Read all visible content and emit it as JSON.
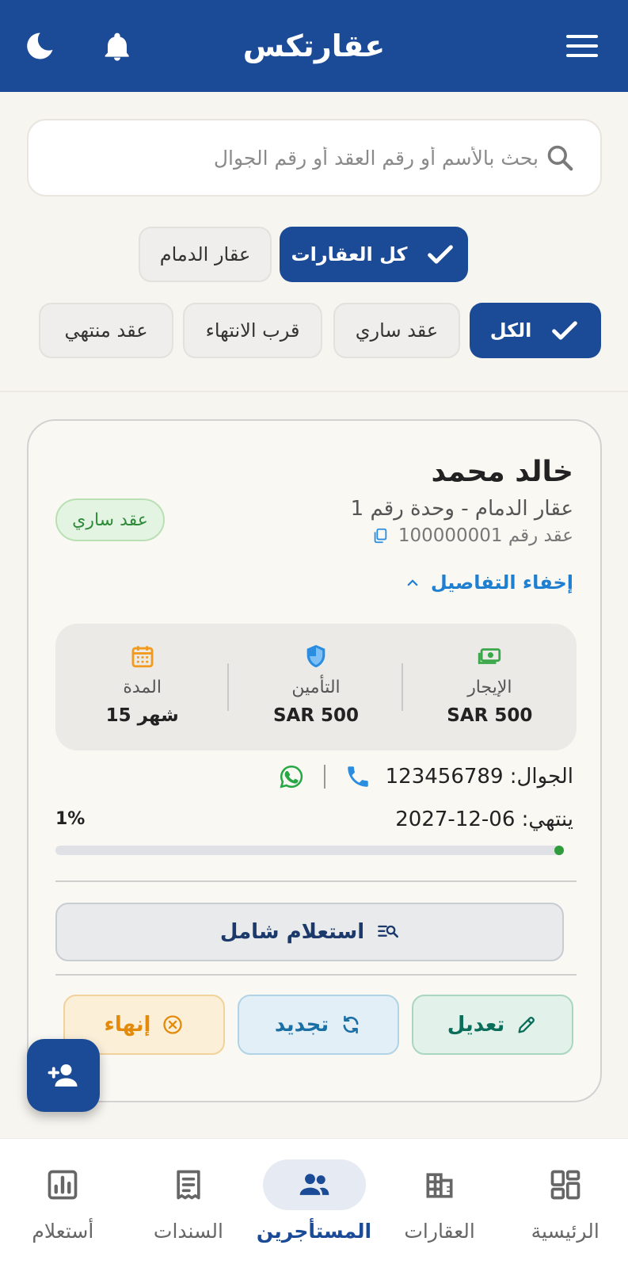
{
  "header": {
    "title": "عقارتكس",
    "colors": {
      "primary": "#1b4a96"
    },
    "icons": {
      "menu": "menu-icon",
      "bell": "bell-icon",
      "theme": "moon-icon"
    }
  },
  "search": {
    "placeholder": "بحث بالأسم أو رقم العقد أو رقم الجوال",
    "value": "",
    "icon": "search-icon"
  },
  "property_filters": [
    {
      "label": "كل العقارات",
      "selected": true
    },
    {
      "label": "عقار الدمام",
      "selected": false
    }
  ],
  "status_filters": [
    {
      "label": "الكل",
      "selected": true
    },
    {
      "label": "عقد ساري",
      "selected": false
    },
    {
      "label": "قرب الانتهاء",
      "selected": false
    },
    {
      "label": "عقد منتهي",
      "selected": false
    }
  ],
  "card": {
    "tenant_name": "خالد محمد",
    "unit": "عقار الدمام - وحدة رقم 1",
    "contract_no": "عقد رقم 100000001",
    "status": {
      "label": "عقد ساري",
      "color": "#2e8b3a"
    },
    "toggle_details": "إخفاء التفاصيل",
    "stats": {
      "rent": {
        "label": "الإيجار",
        "value": "SAR 500",
        "icon": "money-icon"
      },
      "insurance": {
        "label": "التأمين",
        "value": "SAR 500",
        "icon": "shield-icon"
      },
      "duration": {
        "label": "المدة",
        "value": "15 شهر",
        "icon": "calendar-icon"
      }
    },
    "phone": "الجوال: 123456789",
    "ends": "ينتهي: 06-12-2027",
    "progress": {
      "percent_label": "1%",
      "value": 0.01
    },
    "inquiry_button": "استعلام شامل",
    "actions": {
      "edit": "تعديل",
      "renew": "تجديد",
      "end": "إنهاء"
    }
  },
  "fab": {
    "icon": "add-person-icon"
  },
  "bottom_nav": [
    {
      "label": "الرئيسية",
      "icon": "dashboard-icon",
      "active": false
    },
    {
      "label": "العقارات",
      "icon": "building-icon",
      "active": false
    },
    {
      "label": "المستأجرين",
      "icon": "people-icon",
      "active": true
    },
    {
      "label": "السندات",
      "icon": "receipt-icon",
      "active": false
    },
    {
      "label": "أستعلام",
      "icon": "report-icon",
      "active": false
    }
  ]
}
